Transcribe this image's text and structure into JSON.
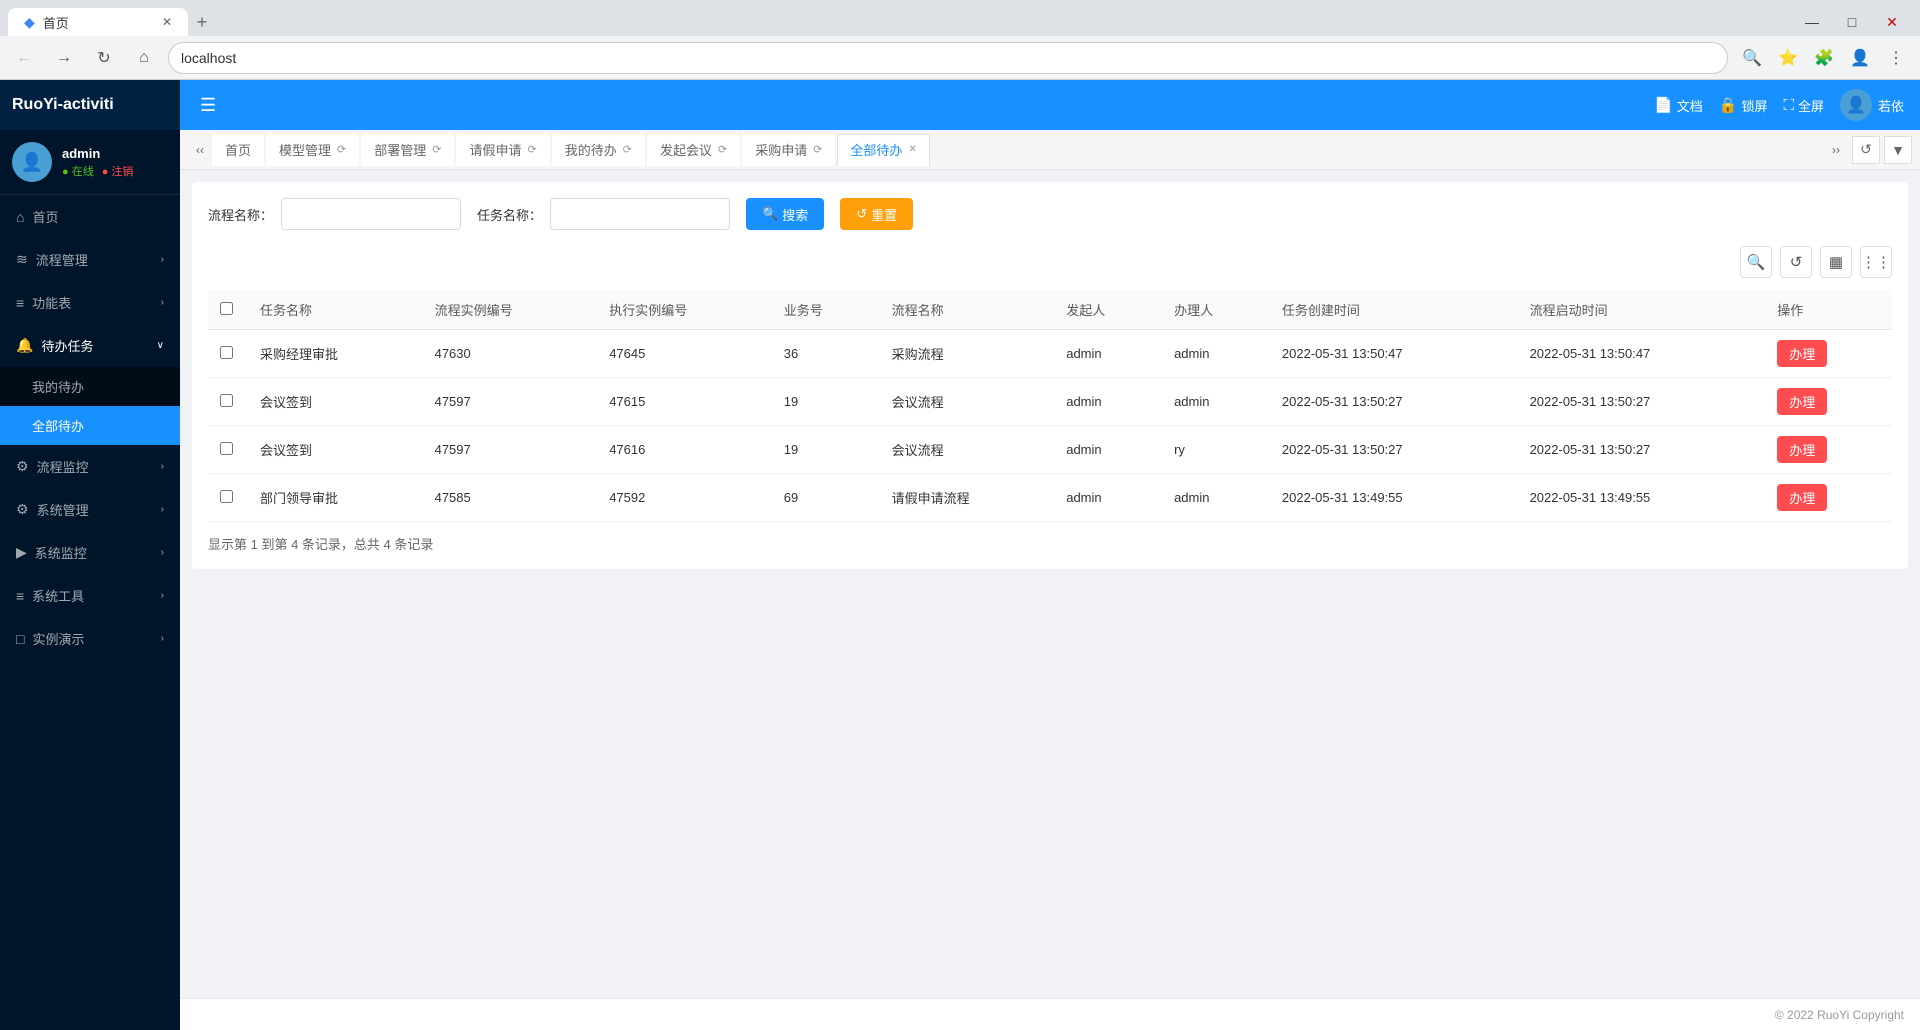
{
  "browser": {
    "tab_title": "首页",
    "tab_icon": "◆",
    "address": "localhost",
    "window_btns": [
      "—",
      "□",
      "✕"
    ]
  },
  "app": {
    "brand": "RuoYi-activiti",
    "header": {
      "menu_toggle": "☰",
      "actions": [
        {
          "icon": "📄",
          "label": "文档"
        },
        {
          "icon": "🔒",
          "label": "锁屏"
        },
        {
          "icon": "⛶",
          "label": "全屏"
        }
      ],
      "user_name": "若依"
    },
    "sidebar": {
      "user": {
        "name": "admin",
        "status": "在线",
        "logout": "注销"
      },
      "menu": [
        {
          "icon": "⌂",
          "label": "首页",
          "active": false,
          "has_sub": false
        },
        {
          "icon": "≋",
          "label": "流程管理",
          "active": false,
          "has_sub": true
        },
        {
          "icon": "≡",
          "label": "功能表",
          "active": false,
          "has_sub": true
        },
        {
          "icon": "🔔",
          "label": "待办任务",
          "active": true,
          "has_sub": true,
          "submenu": [
            {
              "label": "我的待办",
              "active": false
            },
            {
              "label": "全部待办",
              "active": true
            }
          ]
        },
        {
          "icon": "⚙",
          "label": "流程监控",
          "active": false,
          "has_sub": true
        },
        {
          "icon": "⚙",
          "label": "系统管理",
          "active": false,
          "has_sub": true
        },
        {
          "icon": "▶",
          "label": "系统监控",
          "active": false,
          "has_sub": true
        },
        {
          "icon": "≡",
          "label": "系统工具",
          "active": false,
          "has_sub": true
        },
        {
          "icon": "□",
          "label": "实例演示",
          "active": false,
          "has_sub": true
        }
      ]
    },
    "tabs": [
      {
        "label": "首页",
        "closable": false,
        "active": false
      },
      {
        "label": "模型管理",
        "closable": true,
        "active": false
      },
      {
        "label": "部署管理",
        "closable": true,
        "active": false
      },
      {
        "label": "请假申请",
        "closable": true,
        "active": false
      },
      {
        "label": "我的待办",
        "closable": true,
        "active": false
      },
      {
        "label": "发起会议",
        "closable": true,
        "active": false
      },
      {
        "label": "采购申请",
        "closable": true,
        "active": false
      },
      {
        "label": "全部待办",
        "closable": true,
        "active": true
      }
    ],
    "search": {
      "flow_name_label": "流程名称：",
      "flow_name_placeholder": "",
      "task_name_label": "任务名称：",
      "task_name_placeholder": "",
      "search_btn": "搜索",
      "reset_btn": "重置"
    },
    "table": {
      "columns": [
        "",
        "任务名称",
        "流程实例编号",
        "执行实例编号",
        "业务号",
        "流程名称",
        "发起人",
        "办理人",
        "任务创建时间",
        "流程启动时间",
        "操作"
      ],
      "rows": [
        {
          "task_name": "采购经理审批",
          "flow_instance_no": "47630",
          "exec_instance_no": "47645",
          "business_no": "36",
          "flow_name": "采购流程",
          "initiator": "admin",
          "handler": "admin",
          "task_create_time": "2022-05-31 13:50:47",
          "flow_start_time": "2022-05-31 13:50:47",
          "action": "办理"
        },
        {
          "task_name": "会议签到",
          "flow_instance_no": "47597",
          "exec_instance_no": "47615",
          "business_no": "19",
          "flow_name": "会议流程",
          "initiator": "admin",
          "handler": "admin",
          "task_create_time": "2022-05-31 13:50:27",
          "flow_start_time": "2022-05-31 13:50:27",
          "action": "办理"
        },
        {
          "task_name": "会议签到",
          "flow_instance_no": "47597",
          "exec_instance_no": "47616",
          "business_no": "19",
          "flow_name": "会议流程",
          "initiator": "admin",
          "handler": "ry",
          "task_create_time": "2022-05-31 13:50:27",
          "flow_start_time": "2022-05-31 13:50:27",
          "action": "办理"
        },
        {
          "task_name": "部门领导审批",
          "flow_instance_no": "47585",
          "exec_instance_no": "47592",
          "business_no": "69",
          "flow_name": "请假申请流程",
          "initiator": "admin",
          "handler": "admin",
          "task_create_time": "2022-05-31 13:49:55",
          "flow_start_time": "2022-05-31 13:49:55",
          "action": "办理"
        }
      ],
      "pagination": "显示第 1 到第 4 条记录，总共 4 条记录"
    },
    "footer": {
      "copyright": "© 2022 RuoYi Copyright"
    }
  }
}
